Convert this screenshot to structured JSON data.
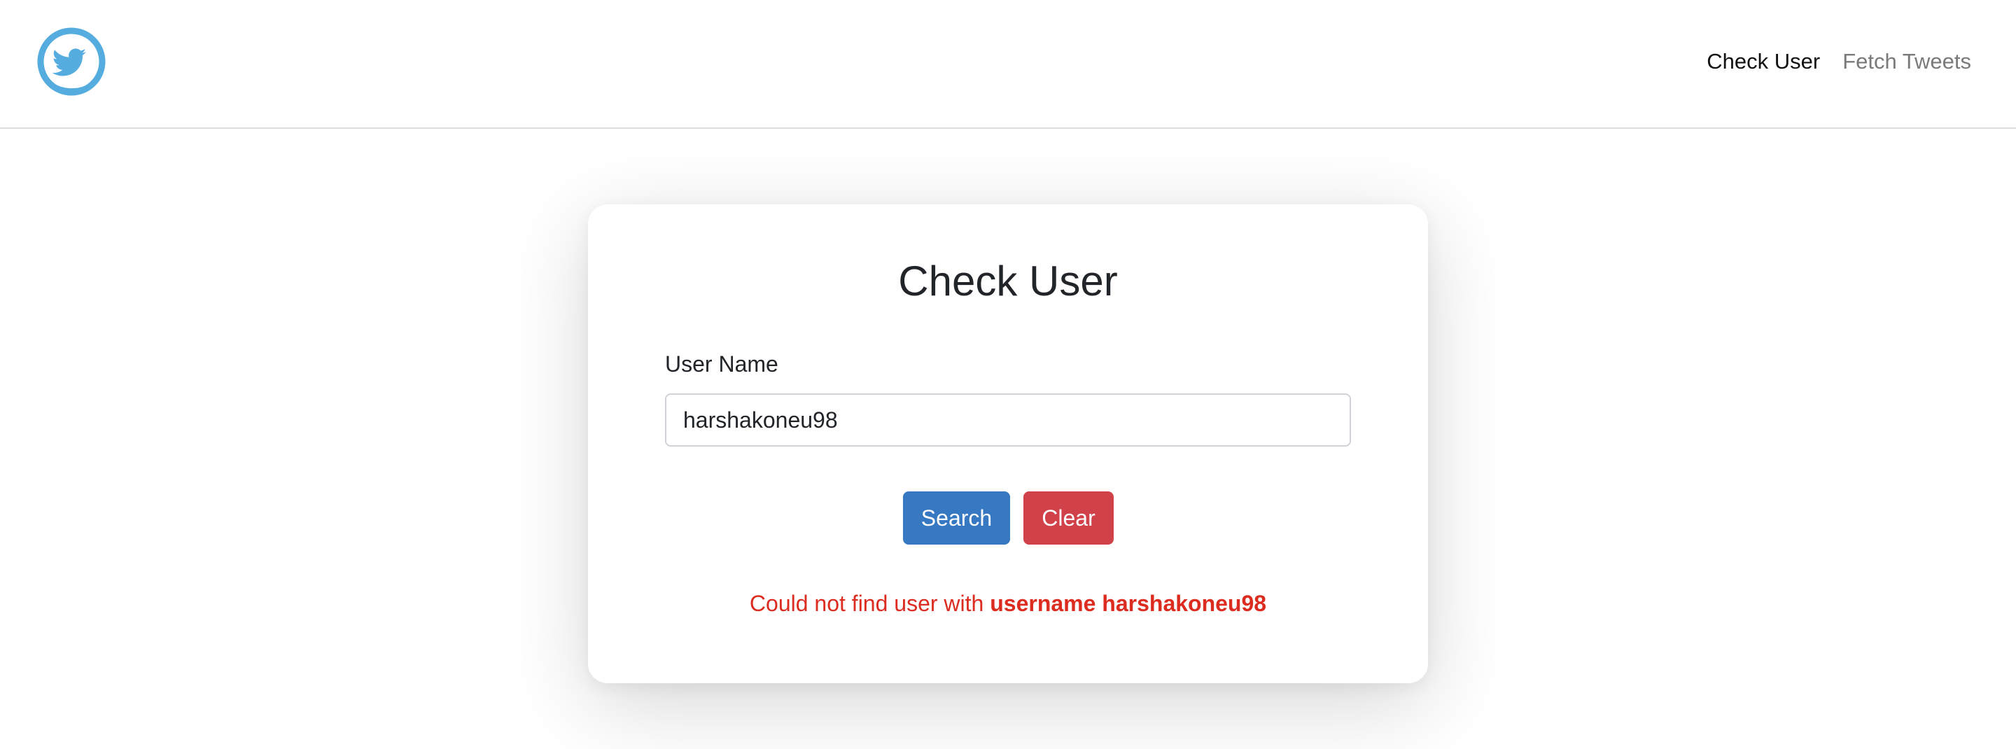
{
  "navbar": {
    "logo_icon": "twitter-bird-logo",
    "links": [
      {
        "label": "Check User",
        "active": true
      },
      {
        "label": "Fetch Tweets",
        "active": false
      }
    ]
  },
  "card": {
    "title": "Check User",
    "field_label": "User Name",
    "username_value": "harshakoneu98",
    "search_label": "Search",
    "clear_label": "Clear",
    "error_prefix": "Could not find user with",
    "error_emphasis": "username harshakoneu98"
  },
  "colors": {
    "accent": "#3778c2",
    "danger": "#d0414a",
    "error_text": "#dc2b1f",
    "logo_blue": "#55acdf"
  }
}
